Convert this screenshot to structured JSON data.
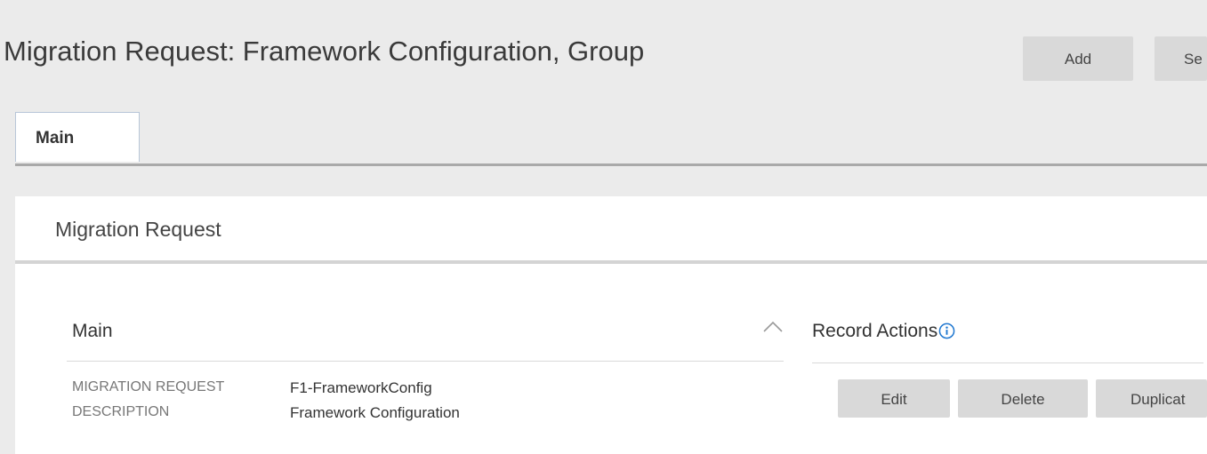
{
  "page": {
    "title": "Migration Request: Framework Configuration, Group"
  },
  "toolbar": {
    "add_label": "Add",
    "search_label": "Se"
  },
  "tabs": [
    {
      "label": "Main"
    }
  ],
  "panel": {
    "title": "Migration Request"
  },
  "main_section": {
    "title": "Main",
    "collapse_icon": "chevron-up-icon",
    "fields": [
      {
        "label": "MIGRATION REQUEST",
        "value": "F1-FrameworkConfig"
      },
      {
        "label": "DESCRIPTION",
        "value": "Framework Configuration"
      }
    ]
  },
  "record_actions": {
    "title": "Record Actions",
    "info_icon": "info-icon",
    "buttons": {
      "edit": "Edit",
      "delete": "Delete",
      "duplicate": "Duplicat"
    }
  },
  "colors": {
    "background": "#ebebeb",
    "button_bg": "#d9d9d9",
    "info_icon": "#1f77d0",
    "tab_border": "#b8c6d8"
  }
}
